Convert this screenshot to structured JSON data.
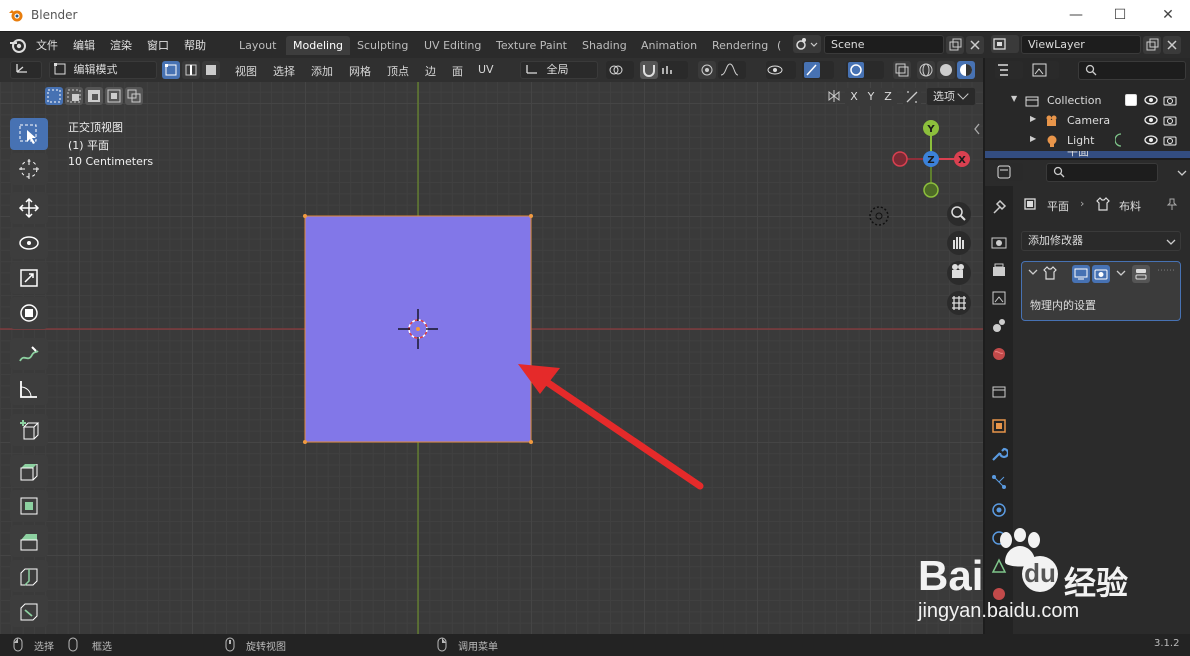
{
  "window": {
    "title": "Blender",
    "minimize": "—",
    "maximize": "☐",
    "close": "✕"
  },
  "menu": [
    "文件",
    "编辑",
    "渲染",
    "窗口",
    "帮助"
  ],
  "workspaces": [
    "Layout",
    "Modeling",
    "Sculpting",
    "UV Editing",
    "Texture Paint",
    "Shading",
    "Animation",
    "Rendering",
    "("
  ],
  "active_workspace": "Modeling",
  "scene": {
    "name": "Scene",
    "view_layer": "ViewLayer"
  },
  "header3d": {
    "mode": "编辑模式",
    "menus": [
      "视图",
      "选择",
      "添加",
      "网格",
      "顶点",
      "边",
      "面",
      "UV"
    ],
    "transform": "全局",
    "options_label": "选项",
    "axes": [
      "X",
      "Y",
      "Z"
    ]
  },
  "viewport": {
    "view_name": "正交顶视图",
    "object": "(1) 平面",
    "scale": "10 Centimeters",
    "mesh_color": "#8277e8",
    "gizmo": {
      "x": "X",
      "y": "Y",
      "z": "Z"
    }
  },
  "outliner": {
    "items": [
      {
        "label": "Collection",
        "indent": 0
      },
      {
        "label": "Camera",
        "indent": 1
      },
      {
        "label": "Light",
        "indent": 1
      },
      {
        "label": "平面",
        "indent": 1
      }
    ]
  },
  "properties": {
    "breadcrumb_object": "平面",
    "breadcrumb_modifier": "布料",
    "add_modifier": "添加修改器",
    "modifier_panel_text": "物理内的设置"
  },
  "status": {
    "select": "选择",
    "box_select": "框选",
    "rotate": "旋转视图",
    "menu": "调用菜单",
    "version": "3.1.2"
  },
  "watermark": {
    "brand": "Bai",
    "brand2": "经验",
    "url": "jingyan.baidu.com"
  },
  "colors": {
    "accent": "#4772b3",
    "arrow": "#e52a2a",
    "x_axis": "#d94050",
    "y_axis": "#8cbf3c",
    "z_axis": "#3c82d9"
  }
}
